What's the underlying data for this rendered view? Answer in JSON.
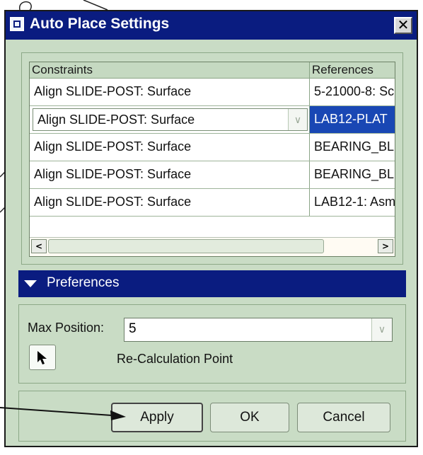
{
  "dialog": {
    "title": "Auto Place Settings",
    "close_symbol": "✕",
    "icon": "window-icon"
  },
  "table": {
    "columns": [
      "Constraints",
      "References"
    ],
    "rows": [
      {
        "constraint": "Align  SLIDE-POST: Surface",
        "reference": "5-21000-8: Sc"
      },
      {
        "constraint": "Align  SLIDE-POST: Surface",
        "reference": "LAB12-PLAT",
        "selected": true,
        "editable": true
      },
      {
        "constraint": "Align  SLIDE-POST: Surface",
        "reference": "BEARING_BL"
      },
      {
        "constraint": "Align  SLIDE-POST: Surface",
        "reference": "BEARING_BL"
      },
      {
        "constraint": "Align  SLIDE-POST: Surface",
        "reference": "LAB12-1: Asm"
      }
    ]
  },
  "preferences": {
    "label": "Preferences",
    "max_position_label": "Max Position:",
    "max_position_value": "5",
    "recalc_label": "Re-Calculation Point"
  },
  "buttons": {
    "apply": "Apply",
    "ok": "OK",
    "cancel": "Cancel"
  },
  "colors": {
    "titlebar": "#0a1c80",
    "dialog_bg": "#c9dcc5",
    "selection": "#1947b4"
  }
}
